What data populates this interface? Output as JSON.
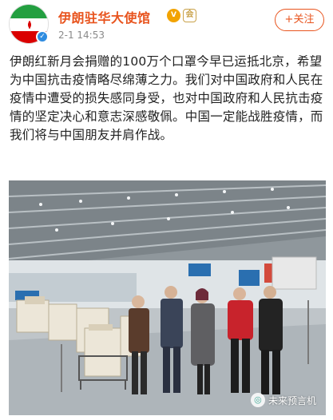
{
  "header": {
    "account_name": "伊朗驻华大使馆",
    "post_time": "2-1 14:53",
    "follow_label": "+关注",
    "verified_mark": "✓",
    "vip_mark": "V",
    "member_mark": "会"
  },
  "post": {
    "text": "伊朗红新月会捐赠的100万个口罩今早已运抵北京，希望为中国抗击疫情略尽绵薄之力。我们对中国政府和人民在疫情中遭受的损失感同身受，也对中国政府和人民抗击疫情的坚定决心和意志深感敬佩。中国一定能战胜疫情，而我们将与中国朋友并肩作战。"
  },
  "photo": {
    "watermark_text": "未来预言机"
  },
  "colors": {
    "accent": "#e8541e",
    "time_gray": "#8a8a8a",
    "flag_green": "#239f40",
    "flag_red": "#da0000"
  }
}
